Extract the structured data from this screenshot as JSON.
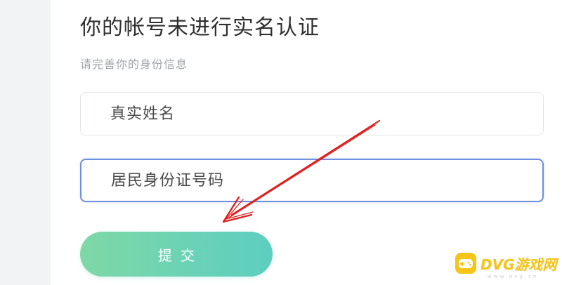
{
  "page": {
    "title": "你的帐号未进行实名认证",
    "subtitle": "请完善你的身份信息"
  },
  "form": {
    "name_placeholder": "真实姓名",
    "name_value": "",
    "id_placeholder": "居民身份证号码",
    "id_value": "",
    "submit_label": "提交"
  },
  "watermark": {
    "text": "DVG游戏网",
    "subtext": "www.dvg.cn"
  },
  "colors": {
    "button_gradient_start": "#7ed8a6",
    "button_gradient_end": "#5dcec0",
    "focus_border": "#6e8fde",
    "annotation_arrow": "#e02020",
    "watermark": "#f5c518"
  },
  "icons": {
    "annotation": "red-arrow-icon",
    "watermark_logo": "gamepad-icon"
  }
}
